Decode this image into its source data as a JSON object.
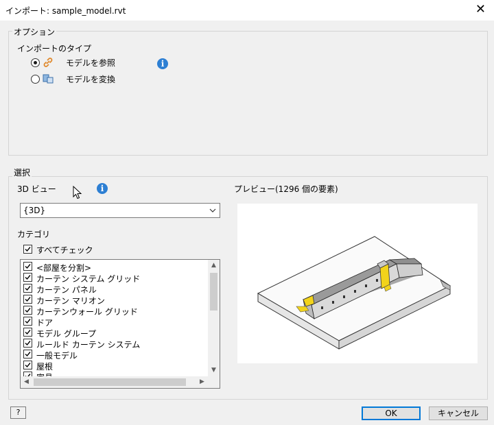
{
  "window": {
    "title": "インポート: sample_model.rvt",
    "close_glyph": "✕"
  },
  "options": {
    "legend": "オプション",
    "import_type_label": "インポートのタイプ",
    "radio_reference": {
      "label": "モデルを参照",
      "checked": true
    },
    "radio_convert": {
      "label": "モデルを変換",
      "checked": false
    },
    "info_glyph": "i"
  },
  "selection": {
    "legend": "選択",
    "view_label": "3D ビュー",
    "view_value": "{3D}",
    "info_glyph": "i",
    "category_label": "カテゴリ",
    "check_all_label": "すべてチェック",
    "check_all_checked": true,
    "categories": [
      "<部屋を分割>",
      "カーテン システム グリッド",
      "カーテン パネル",
      "カーテン マリオン",
      "カーテンウォール グリッド",
      "ドア",
      "モデル グループ",
      "ルールド カーテン システム",
      "一般モデル",
      "屋根",
      "家具"
    ],
    "preview_label": "プレビュー(1296 個の要素)"
  },
  "footer": {
    "help_glyph": "?",
    "ok_label": "OK",
    "cancel_label": "キャンセル"
  },
  "colors": {
    "accent": "#2d7fd3",
    "default_button_border": "#0078d7",
    "preview_highlight": "#f2d31b"
  }
}
